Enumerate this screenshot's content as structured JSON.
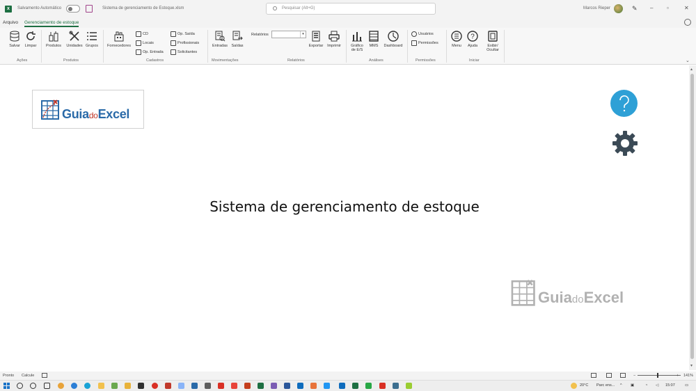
{
  "titlebar": {
    "autosave_label": "Salvamento Automático",
    "document_name": "Sistema de gerenciamento de Estoque.xlsm",
    "search_placeholder": "Pesquisar (Alt+G)",
    "user_name": "Marcos Rieper",
    "minimize": "–",
    "maximize": "▫",
    "close": "✕"
  },
  "tabs": [
    {
      "label": "Arquivo"
    },
    {
      "label": "Gerenciamento de estoque"
    }
  ],
  "ribbon": {
    "acoes": {
      "group_label": "Ações",
      "salvar": "Salvar",
      "limpar": "Limpar"
    },
    "produtos": {
      "group_label": "Produtos",
      "produtos": "Produtos",
      "unidades": "Unidades",
      "grupos": "Grupos"
    },
    "cadastros": {
      "group_label": "Cadastros",
      "fornecedores": "Fornecedores",
      "cd": "CD",
      "locais": "Locais",
      "op_entrada": "Op. Entrada",
      "op_saida": "Op. Saída",
      "profissionais": "Profissionais",
      "solicitantes": "Solicitantes"
    },
    "movimentacoes": {
      "group_label": "Movimentações",
      "entradas": "Entradas",
      "saidas": "Saídas"
    },
    "relatorios": {
      "group_label": "Relatórios",
      "relatorios_label": "Relatórios",
      "relatorios_value": "",
      "exportar": "Exportar",
      "imprimir": "Imprimir"
    },
    "analises": {
      "group_label": "Análises",
      "grafico": "Gráfico de E/S",
      "mms": "MMS",
      "dashboard": "Dashboard"
    },
    "permissoes": {
      "group_label": "Permissões",
      "usuarios": "Usuários",
      "permissoes": "Permissões"
    },
    "iniciar": {
      "group_label": "Iniciar",
      "menu": "Menu",
      "ajuda": "Ajuda",
      "exibir_ocultar": "Exibir/ Ocultar"
    }
  },
  "sheet": {
    "logo_brand_a": "Guia",
    "logo_brand_b": "do",
    "logo_brand_c": "Excel",
    "title": "Sistema de gerenciamento de estoque",
    "watermark_a": "Guia",
    "watermark_b": "do",
    "watermark_c": "Excel"
  },
  "statusbar": {
    "status": "Pronto",
    "calc": "Calcule",
    "zoom": "141%"
  },
  "taskbar": {
    "weather": "20°C",
    "weather_desc": "Parc ens...",
    "time": "15:07"
  },
  "colors": {
    "excel_green": "#1d6f42",
    "help_blue": "#2ea0d6",
    "gear_gray": "#3b4a56",
    "brand_blue": "#2a6aa8",
    "brand_red": "#c0392b"
  }
}
